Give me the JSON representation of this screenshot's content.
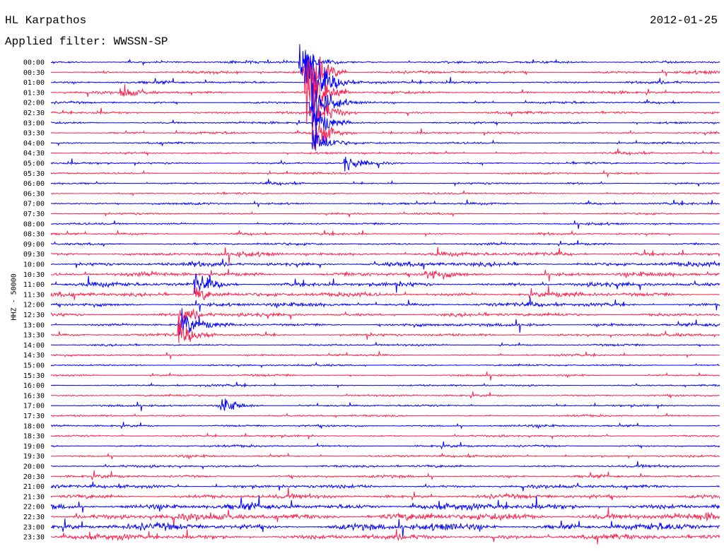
{
  "header": {
    "station": "HL Karpathos",
    "date": "2012-01-25",
    "filter": "Applied filter: WWSSN-SP"
  },
  "chart_data": {
    "type": "line",
    "title": "HL Karpathos",
    "date": "2012-01-25",
    "filter": "WWSSN-SP",
    "ylabel": "HHZ - 50000",
    "row_labels": [
      "00:00",
      "00:30",
      "01:00",
      "01:30",
      "02:00",
      "02:30",
      "03:00",
      "03:30",
      "04:00",
      "04:30",
      "05:00",
      "05:30",
      "06:00",
      "06:30",
      "07:00",
      "07:30",
      "08:00",
      "08:30",
      "09:00",
      "09:30",
      "10:00",
      "10:30",
      "11:00",
      "11:30",
      "12:00",
      "12:30",
      "13:00",
      "13:30",
      "14:00",
      "14:30",
      "15:00",
      "15:30",
      "16:00",
      "16:30",
      "17:00",
      "17:30",
      "18:00",
      "18:30",
      "19:00",
      "19:30",
      "20:00",
      "20:30",
      "21:00",
      "21:30",
      "22:00",
      "22:30",
      "23:00",
      "23:30"
    ],
    "series_colors": [
      "#0000ff",
      "#ff1f4b"
    ],
    "minutes_per_row": 30,
    "row_noise_level": [
      0.5,
      0.55,
      0.55,
      0.55,
      0.45,
      0.55,
      0.45,
      0.45,
      0.4,
      0.4,
      0.45,
      0.4,
      0.4,
      0.4,
      0.45,
      0.4,
      0.4,
      0.45,
      0.5,
      0.8,
      0.95,
      0.85,
      0.9,
      0.9,
      0.8,
      0.75,
      0.7,
      0.6,
      0.4,
      0.4,
      0.4,
      0.4,
      0.4,
      0.4,
      0.4,
      0.4,
      0.45,
      0.45,
      0.45,
      0.45,
      0.5,
      0.55,
      0.75,
      0.9,
      1.3,
      1.5,
      1.4,
      1.1
    ],
    "events": [
      {
        "row": 0,
        "minute": 11.2,
        "amplitude": 3.5
      },
      {
        "row": 1,
        "minute": 11.4,
        "amplitude": 9
      },
      {
        "row": 2,
        "minute": 11.5,
        "amplitude": 10
      },
      {
        "row": 3,
        "minute": 11.6,
        "amplitude": 8
      },
      {
        "row": 4,
        "minute": 11.7,
        "amplitude": 6
      },
      {
        "row": 5,
        "minute": 11.8,
        "amplitude": 5
      },
      {
        "row": 6,
        "minute": 11.8,
        "amplitude": 4
      },
      {
        "row": 7,
        "minute": 11.8,
        "amplitude": 4
      },
      {
        "row": 8,
        "minute": 11.8,
        "amplitude": 4
      },
      {
        "row": 3,
        "minute": 3.2,
        "amplitude": 1.6
      },
      {
        "row": 10,
        "minute": 13.2,
        "amplitude": 1.8
      },
      {
        "row": 22,
        "minute": 6.5,
        "amplitude": 2.2
      },
      {
        "row": 23,
        "minute": 6.5,
        "amplitude": 2
      },
      {
        "row": 25,
        "minute": 5.8,
        "amplitude": 2.4
      },
      {
        "row": 26,
        "minute": 5.8,
        "amplitude": 2.6
      },
      {
        "row": 27,
        "minute": 5.8,
        "amplitude": 2.2
      },
      {
        "row": 34,
        "minute": 7.7,
        "amplitude": 2
      },
      {
        "row": 21,
        "minute": 16.8,
        "amplitude": 1.5
      }
    ]
  }
}
